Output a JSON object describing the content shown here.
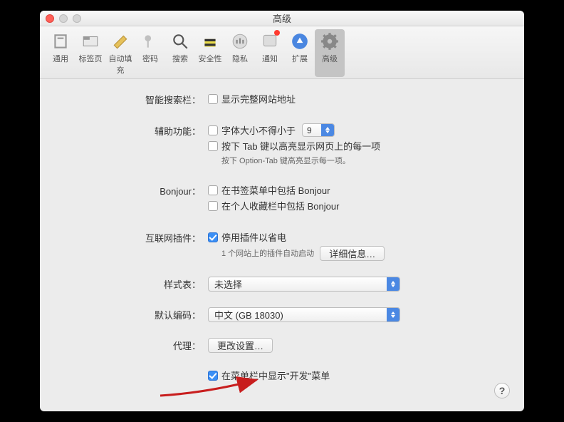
{
  "window": {
    "title": "高级"
  },
  "toolbar": {
    "items": [
      {
        "label": "通用"
      },
      {
        "label": "标签页"
      },
      {
        "label": "自动填充"
      },
      {
        "label": "密码"
      },
      {
        "label": "搜索"
      },
      {
        "label": "安全性"
      },
      {
        "label": "隐私"
      },
      {
        "label": "通知"
      },
      {
        "label": "扩展"
      },
      {
        "label": "高级"
      }
    ]
  },
  "sections": {
    "smartSearch": {
      "label": "智能搜索栏：",
      "showFullURL": "显示完整网站地址"
    },
    "accessibility": {
      "label": "辅助功能：",
      "fontSizeMin": "字体大小不得小于",
      "fontSizeValue": "9",
      "tabHighlight": "按下 Tab 键以高亮显示网页上的每一项",
      "optionTabHint": "按下 Option-Tab 键高亮显示每一项。"
    },
    "bonjour": {
      "label": "Bonjour：",
      "inBookmarks": "在书签菜单中包括 Bonjour",
      "inFavorites": "在个人收藏栏中包括 Bonjour"
    },
    "plugins": {
      "label": "互联网插件：",
      "stopToSave": "停用插件以省电",
      "count": "1 个网站上的插件自动启动",
      "detailsBtn": "详细信息…"
    },
    "stylesheet": {
      "label": "样式表：",
      "value": "未选择"
    },
    "encoding": {
      "label": "默认编码：",
      "value": "中文 (GB 18030)"
    },
    "proxy": {
      "label": "代理：",
      "button": "更改设置…"
    },
    "develop": {
      "label": "在菜单栏中显示\"开发\"菜单"
    }
  },
  "help": "?"
}
